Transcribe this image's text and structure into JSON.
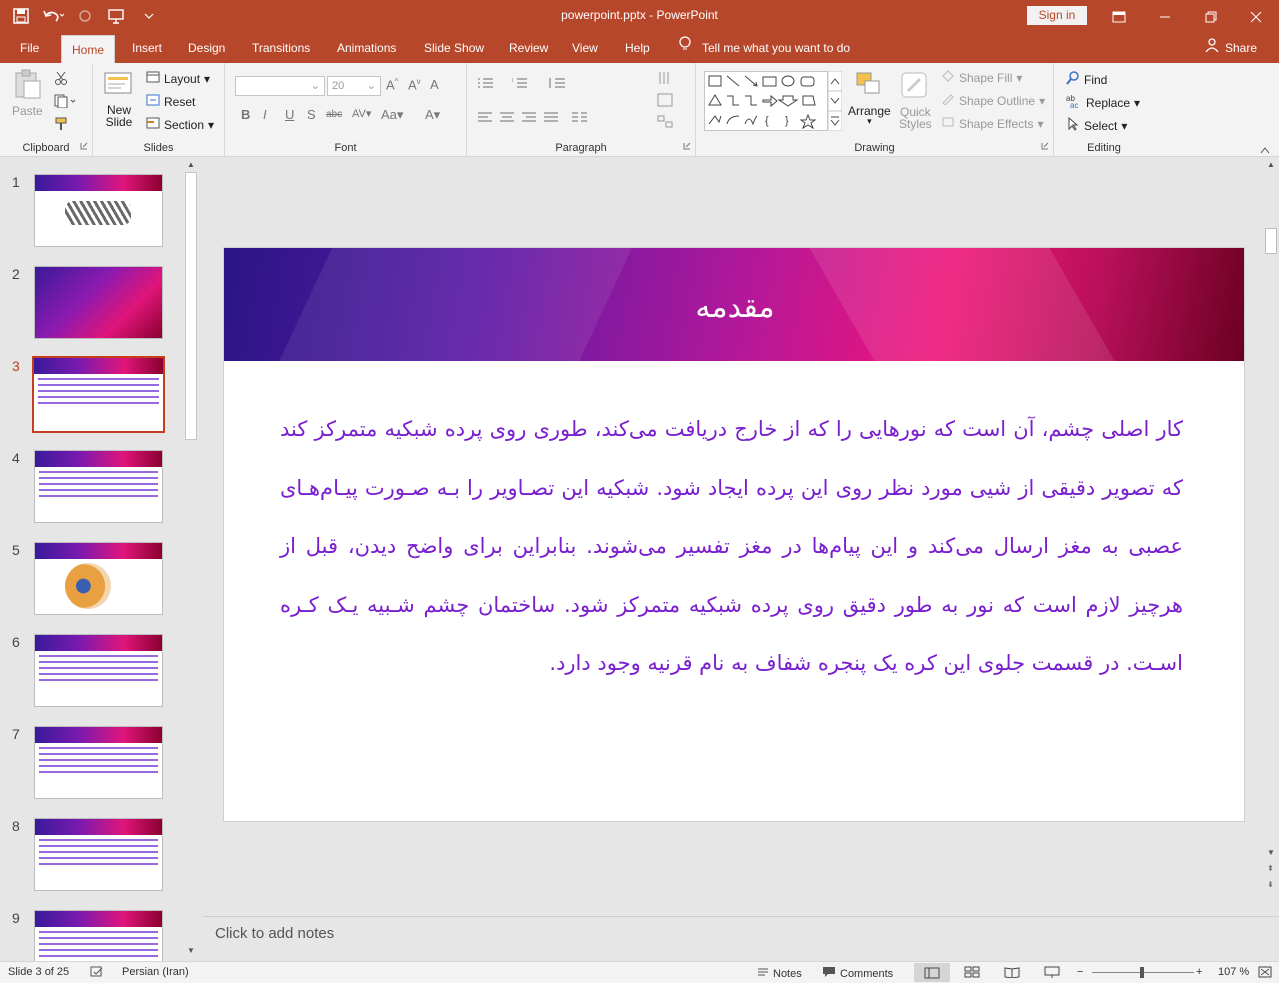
{
  "window": {
    "title": "powerpoint.pptx  -  PowerPoint",
    "sign_in": "Sign in"
  },
  "menu": {
    "tabs": [
      "File",
      "Home",
      "Insert",
      "Design",
      "Transitions",
      "Animations",
      "Slide Show",
      "Review",
      "View",
      "Help"
    ],
    "active_tab": "Home",
    "tell_me": "Tell me what you want to do",
    "share": "Share"
  },
  "ribbon": {
    "clipboard": {
      "label": "Clipboard",
      "paste": "Paste"
    },
    "slides": {
      "label": "Slides",
      "new_slide_1": "New",
      "new_slide_2": "Slide",
      "layout": "Layout",
      "reset": "Reset",
      "section": "Section"
    },
    "font": {
      "label": "Font",
      "font_size": "20"
    },
    "paragraph": {
      "label": "Paragraph"
    },
    "drawing": {
      "label": "Drawing",
      "arrange": "Arrange",
      "quick_styles_1": "Quick",
      "quick_styles_2": "Styles",
      "shape_fill": "Shape Fill",
      "shape_outline": "Shape Outline",
      "shape_effects": "Shape Effects"
    },
    "editing": {
      "label": "Editing",
      "find": "Find",
      "replace": "Replace",
      "select": "Select"
    }
  },
  "thumbnails": [
    {
      "num": "1",
      "kind": "title"
    },
    {
      "num": "2",
      "kind": "image"
    },
    {
      "num": "3",
      "kind": "text"
    },
    {
      "num": "4",
      "kind": "text"
    },
    {
      "num": "5",
      "kind": "diagram"
    },
    {
      "num": "6",
      "kind": "text"
    },
    {
      "num": "7",
      "kind": "text"
    },
    {
      "num": "8",
      "kind": "text"
    },
    {
      "num": "9",
      "kind": "text"
    }
  ],
  "active_slide": 3,
  "slide": {
    "title": "مقدمه",
    "body": "کار اصلی چشم، آن است که نورهایی را که از خارج دریافت می‌کند، طوری روی پرده شبکیه متمرکز کند که تصویر دقیقی از شیی مورد نظر روی این پرده ایجاد شود. شبکیه این تصـاویر را بـه صـورت پیـام‌هـای عصبی به مغز ارسال می‌کند و این پیام‌ها در مغز تفسیر می‌شوند. بنابراین برای واضح دیدن، قبل از هرچیز لازم است که نور به طور دقیق روی پرده شبکیه متمرکز شود. ساختمان چشم شـبیه یـک کـره اسـت. در قسمت جلوی این کره یک پنجره شفاف به نام قرنیه وجود دارد."
  },
  "notes_placeholder": "Click to add notes",
  "status": {
    "slide_info": "Slide 3 of 25",
    "language": "Persian (Iran)",
    "notes": "Notes",
    "comments": "Comments",
    "zoom": "107 %"
  },
  "colors": {
    "accent": "#b7472a",
    "body_text": "#7a1fd0"
  }
}
